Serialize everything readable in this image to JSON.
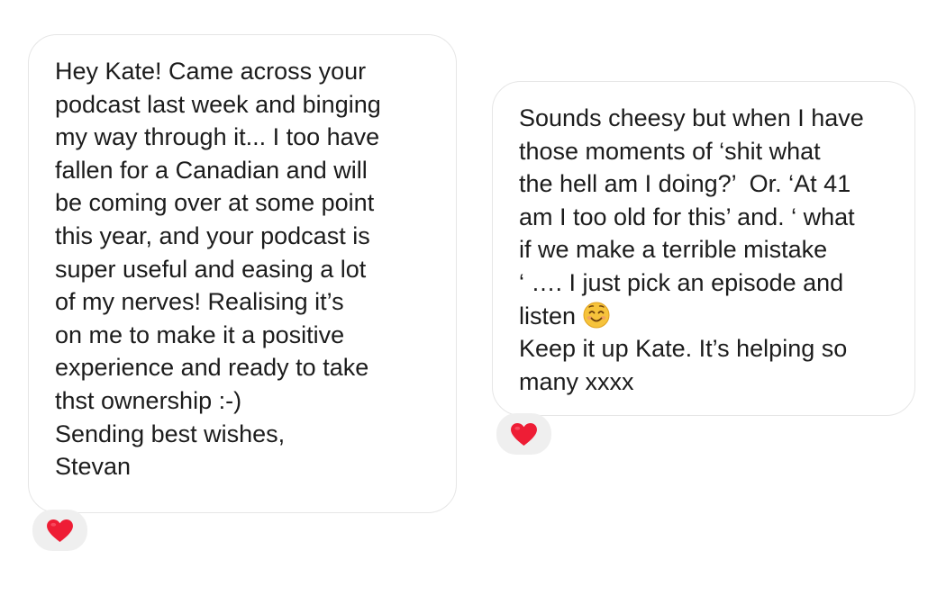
{
  "messages": [
    {
      "lines": [
        "Hey Kate! Came across your",
        "podcast last week and binging",
        "my way through it... I too have",
        "fallen for a Canadian and will",
        "be coming over at some point",
        "this year, and your podcast is",
        "super useful and easing a lot",
        "of my nerves! Realising it’s",
        "on me to make it a positive",
        "experience and ready to take",
        "thst ownership :-)",
        "Sending best wishes,",
        "Stevan"
      ],
      "reaction": "red-heart-icon"
    },
    {
      "lines": [
        "Sounds cheesy but when I have",
        "those moments of ‘shit what",
        "the hell am I doing?’  Or. ‘At 41",
        "am I too old for this’ and. ‘ what",
        "if we make a terrible mistake",
        "‘ …. I just pick an episode and",
        "listen ",
        "Keep it up Kate. It’s helping so",
        "many xxxx"
      ],
      "inline_emoji": "smiling-face-icon",
      "reaction": "red-heart-icon"
    }
  ],
  "colors": {
    "heart": "#ee1d35",
    "bubble_border": "#e6e6e6",
    "reaction_bg": "#efefef",
    "text": "#1c1c1c",
    "emoji_face": "#f6c33b"
  }
}
